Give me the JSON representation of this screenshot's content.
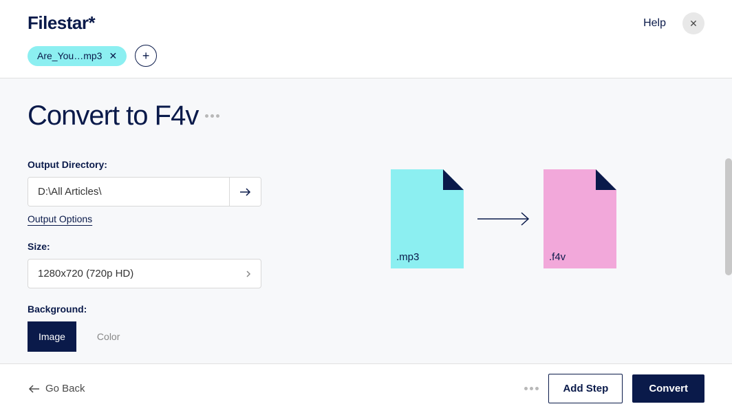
{
  "header": {
    "logo": "Filestar*",
    "help_label": "Help"
  },
  "file_chip": {
    "label": "Are_You…mp3"
  },
  "page": {
    "title": "Convert to F4v"
  },
  "output_directory": {
    "label": "Output Directory:",
    "value": "D:\\All Articles\\",
    "options_link": "Output Options"
  },
  "size": {
    "label": "Size:",
    "value": "1280x720 (720p HD)"
  },
  "background": {
    "label": "Background:",
    "option_image": "Image",
    "option_color": "Color"
  },
  "preview": {
    "source_ext": ".mp3",
    "target_ext": ".f4v",
    "source_color": "#8ceff1",
    "target_color": "#f2a8da"
  },
  "footer": {
    "go_back": "Go Back",
    "add_step": "Add Step",
    "convert": "Convert"
  }
}
